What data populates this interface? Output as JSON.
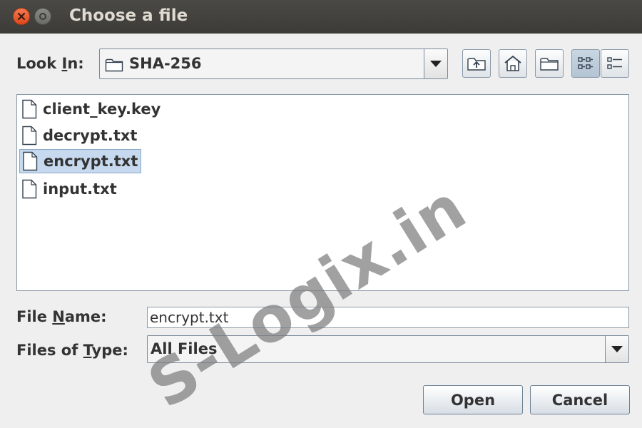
{
  "window": {
    "title": "Choose a file"
  },
  "look_in": {
    "label_pre": "Look ",
    "label_mnemonic": "I",
    "label_post": "n:",
    "value": "SHA-256"
  },
  "toolbar": {
    "icons": [
      "up-one-level-icon",
      "home-icon",
      "new-folder-icon",
      "list-view-icon",
      "details-view-icon"
    ]
  },
  "files": [
    {
      "name": "client_key.key",
      "selected": false
    },
    {
      "name": "decrypt.txt",
      "selected": false
    },
    {
      "name": "encrypt.txt",
      "selected": true
    },
    {
      "name": "input.txt",
      "selected": false
    }
  ],
  "file_name": {
    "label_pre": "File ",
    "label_mnemonic": "N",
    "label_post": "ame:",
    "value": "encrypt.txt"
  },
  "file_type": {
    "label_pre": "Files of ",
    "label_mnemonic": "T",
    "label_post": "ype:",
    "value": "All Files"
  },
  "buttons": {
    "open": "Open",
    "cancel": "Cancel"
  },
  "watermark": "S-Logix.in",
  "colors": {
    "titlebar": "#3c3b37",
    "close_button": "#e0461a",
    "selection": "#c7d9ee"
  }
}
